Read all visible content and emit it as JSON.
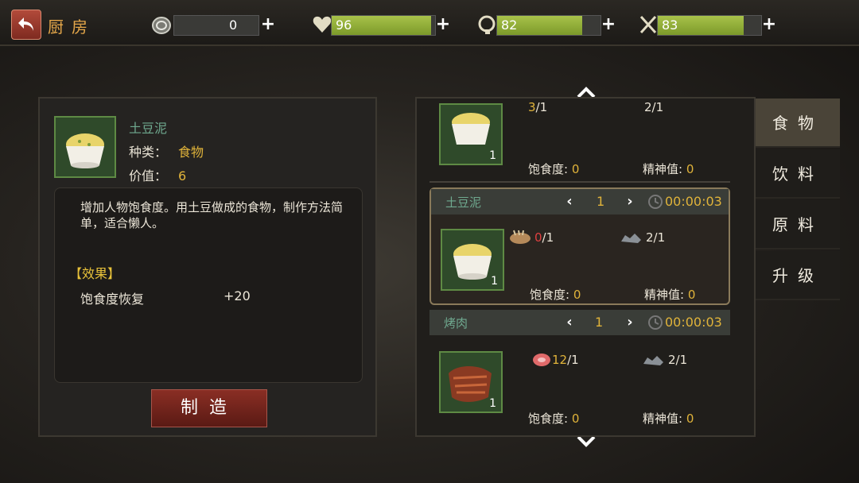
{
  "header": {
    "title": "厨房",
    "coins": "0",
    "health": "96",
    "health_fill": 0.96,
    "mind": "82",
    "mind_fill": 0.82,
    "hunger": "83",
    "hunger_fill": 0.83,
    "plus": "+"
  },
  "detail": {
    "name": "土豆泥",
    "type_label": "种类：",
    "type_value": "食物",
    "price_label": "价值：",
    "price_value": "6",
    "description": "增加人物饱食度。用土豆做成的食物，制作方法简单，适合懒人。",
    "effect_title": "【效果】",
    "effect_name": "饱食度恢复",
    "effect_value": "+20",
    "make_button": "制造"
  },
  "recipes": [
    {
      "name": "",
      "ing1": {
        "have": "3",
        "need": "/1"
      },
      "ing2": {
        "have": "2",
        "need": "/1"
      },
      "count": "1",
      "hunger_label": "饱食度:",
      "hunger_value": "0",
      "spirit_label": "精神值:",
      "spirit_value": "0"
    },
    {
      "name": "土豆泥",
      "qty": "1",
      "timer": "00:00:03",
      "ing1": {
        "have": "0",
        "need": "/1"
      },
      "ing2": {
        "have": "2",
        "need": "/1"
      },
      "count": "1",
      "hunger_label": "饱食度:",
      "hunger_value": "0",
      "spirit_label": "精神值:",
      "spirit_value": "0"
    },
    {
      "name": "烤肉",
      "qty": "1",
      "timer": "00:00:03",
      "ing1": {
        "have": "12",
        "need": "/1"
      },
      "ing2": {
        "have": "2",
        "need": "/1"
      },
      "count": "1",
      "hunger_label": "饱食度:",
      "hunger_value": "0",
      "spirit_label": "精神值:",
      "spirit_value": "0"
    }
  ],
  "tabs": [
    "食物",
    "饮料",
    "原料",
    "升级"
  ],
  "icons": {
    "back": "back-arrow-icon",
    "coin": "coin-icon",
    "heart": "heart-icon",
    "brain": "brain-icon",
    "utensils": "fork-knife-icon",
    "potato": "potato-icon",
    "coal": "coal-icon",
    "meat": "meat-icon",
    "clock": "clock-icon"
  },
  "colors": {
    "accent": "#e0b33a",
    "name_green": "#6fa98f",
    "bar_fill": "#a8c24a",
    "danger": "#e04040"
  }
}
